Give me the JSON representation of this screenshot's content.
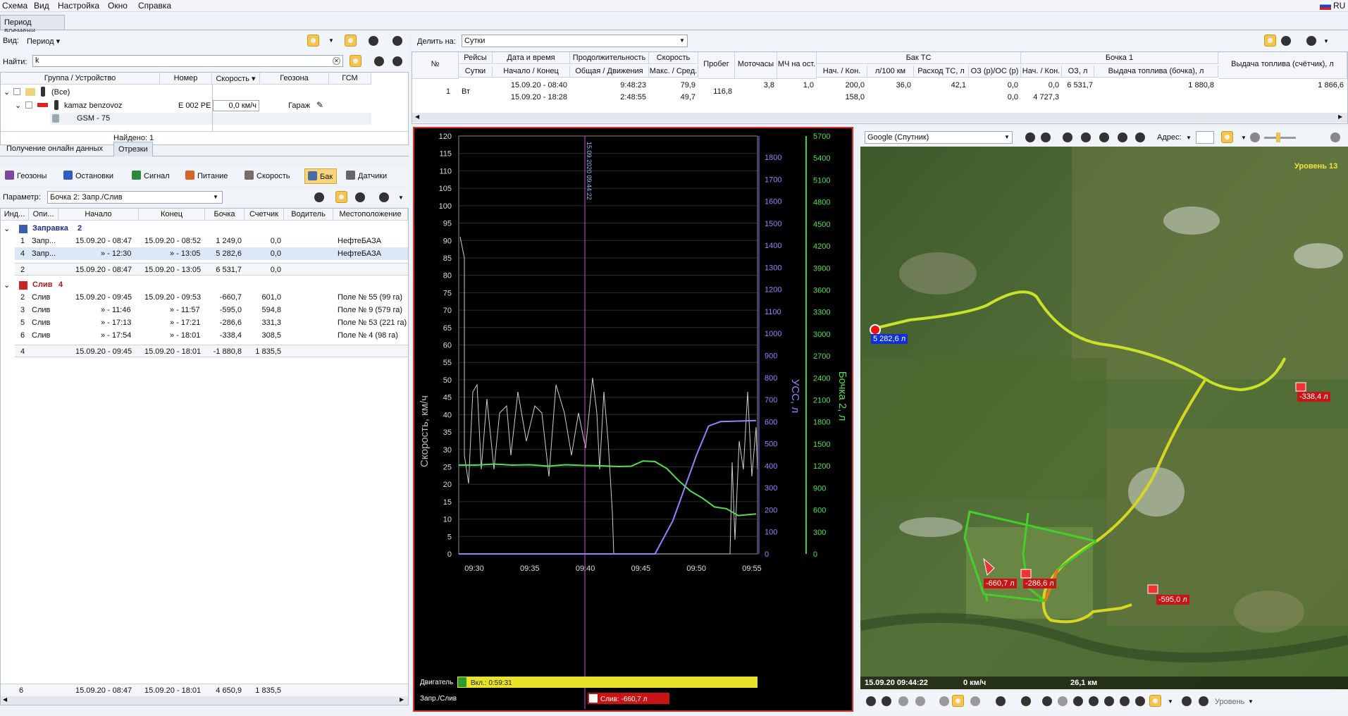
{
  "menu": {
    "items": [
      "Схема",
      "Вид",
      "Настройка",
      "Окно",
      "Справка"
    ],
    "lang": "RU"
  },
  "top_tab": "Период времени",
  "left": {
    "view_label": "Вид:",
    "view_value": "Период ▾",
    "find_label": "Найти:",
    "find_value": "k",
    "columns": [
      "Группа / Устройство",
      "Номер",
      "Скорость ▾",
      "Геозона",
      "ГСМ"
    ],
    "rows": {
      "all": "(Все)",
      "device": "kamaz benzovoz",
      "number": "E 002 PE",
      "speed": "0,0 км/ч",
      "zone": "Гараж",
      "sub": "GSM - 75"
    },
    "found": "Найдено: 1",
    "subtabs": [
      "Получение онлайн данных",
      "Отрезки"
    ],
    "filters": [
      "Геозоны",
      "Остановки",
      "Сигнал",
      "Питание",
      "Скорость",
      "Бак",
      "Датчики"
    ],
    "param_label": "Параметр:",
    "param_value": "Бочка 2: Запр./Слив",
    "seg_columns": [
      "Инд...",
      "Опи...",
      "Начало",
      "Конец",
      "Бочка",
      "Счетчик",
      "Водитель",
      "Местоположение"
    ],
    "group1": {
      "title": "Заправка",
      "count": "2"
    },
    "refuel": [
      {
        "idx": "1",
        "op": "Запр...",
        "start": "15.09.20 - 08:47",
        "end": "15.09.20 - 08:52",
        "tank": "1 249,0",
        "cnt": "0,0",
        "loc": "НефтеБАЗА"
      },
      {
        "idx": "4",
        "op": "Запр...",
        "start": "» - 12:30",
        "end": "» - 13:05",
        "tank": "5 282,6",
        "cnt": "0,0",
        "loc": "НефтеБАЗА"
      }
    ],
    "refuel_sum": {
      "idx": "2",
      "start": "15.09.20 - 08:47",
      "end": "15.09.20 - 13:05",
      "tank": "6 531,7",
      "cnt": "0,0"
    },
    "group2": {
      "title": "Слив",
      "count": "4"
    },
    "drain": [
      {
        "idx": "2",
        "op": "Слив",
        "start": "15.09.20 - 09:45",
        "end": "15.09.20 - 09:53",
        "tank": "-660,7",
        "cnt": "601,0",
        "loc": "Поле № 55 (99 га)"
      },
      {
        "idx": "3",
        "op": "Слив",
        "start": "» - 11:46",
        "end": "» - 11:57",
        "tank": "-595,0",
        "cnt": "594,8",
        "loc": "Поле № 9 (579 га)"
      },
      {
        "idx": "5",
        "op": "Слив",
        "start": "» - 17:13",
        "end": "» - 17:21",
        "tank": "-286,6",
        "cnt": "331,3",
        "loc": "Поле № 53 (221 га)"
      },
      {
        "idx": "6",
        "op": "Слив",
        "start": "» - 17:54",
        "end": "» - 18:01",
        "tank": "-338,4",
        "cnt": "308,5",
        "loc": "Поле № 4 (98 га)"
      }
    ],
    "drain_sum": {
      "idx": "4",
      "start": "15.09.20 - 09:45",
      "end": "15.09.20 - 18:01",
      "tank": "-1 880,8",
      "cnt": "1 835,5"
    },
    "total": {
      "idx": "6",
      "start": "15.09.20 - 08:47",
      "end": "15.09.20 - 18:01",
      "tank": "4 650,9",
      "cnt": "1 835,5"
    }
  },
  "report": {
    "split_label": "Делить на:",
    "split_value": "Сутки",
    "h1": [
      "№",
      "Рейсы",
      "Дата и время",
      "Продолжительность",
      "Скорость",
      "Пробег",
      "Моточасы",
      "МЧ на ост.",
      "Бак ТС",
      "Бочка 1",
      "Выдача топлива (счётчик), л"
    ],
    "h2": [
      "Сутки",
      "Начало / Конец",
      "Общая / Движения",
      "Макс. / Сред.",
      "Нач. / Кон.",
      "л/100 км",
      "Расход ТС, л",
      "ОЗ (р)/ОС (р)",
      "Нач. / Кон.",
      "ОЗ, л",
      "Выдача топлива (бочка), л"
    ],
    "row": {
      "n": "1",
      "day": "Вт",
      "dt1": "15.09.20 - 08:40",
      "dt2": "15.09.20 - 18:28",
      "dur1": "9:48:23",
      "dur2": "2:48:55",
      "sp1": "79,9",
      "sp2": "49,7",
      "mil": "116,8",
      "moto": "3,8",
      "mch": "1,0",
      "tank1": "200,0",
      "tank2": "158,0",
      "l100": "36,0",
      "cons": "42,1",
      "oz1": "0,0",
      "oz2": "0,0",
      "b1a": "0,0",
      "b1b": "4 727,3",
      "oz": "6 531,7",
      "barrel": "1 880,8",
      "counter": "1 866,6"
    }
  },
  "chart_data": {
    "type": "line",
    "x_ticks": [
      "09:30",
      "09:35",
      "09:40",
      "09:45",
      "09:50",
      "09:55"
    ],
    "y_left": {
      "label": "Скорость, км/ч",
      "ticks": [
        "120",
        "115",
        "110",
        "105",
        "100",
        "95",
        "90",
        "85",
        "80",
        "75",
        "70",
        "65",
        "60",
        "55",
        "50",
        "45",
        "40",
        "35",
        "30",
        "25",
        "20",
        "15",
        "10",
        "5",
        "0"
      ]
    },
    "y_mid": {
      "label": "УСС, л",
      "ticks": [
        "1800",
        "1700",
        "1600",
        "1500",
        "1400",
        "1300",
        "1200",
        "1100",
        "1000",
        "900",
        "800",
        "700",
        "600",
        "500",
        "400",
        "300",
        "200",
        "100",
        "0"
      ]
    },
    "y_right": {
      "label": "Бочка 2, л",
      "ticks": [
        "5700",
        "5400",
        "5100",
        "4800",
        "4500",
        "4200",
        "3900",
        "3600",
        "3300",
        "3000",
        "2700",
        "2400",
        "2100",
        "1800",
        "1500",
        "1200",
        "900",
        "600",
        "300",
        "0"
      ]
    },
    "cursor": "15.09.2020 09:44:22",
    "engine_label": "Двигатель",
    "engine_value": "Вкл.: 0:59:31",
    "drain_label": "Запр./Слив",
    "drain_value": "Слив: -660,7 л",
    "series": [
      {
        "name": "Бочка 2",
        "color": "#4fe04f",
        "x": [
          0,
          6,
          12,
          18,
          24,
          30,
          36,
          42,
          48,
          54,
          58,
          62,
          66,
          70,
          74,
          78,
          82,
          86,
          90,
          94,
          100
        ],
        "y": [
          25.5,
          25.5,
          25.8,
          25.5,
          25.6,
          25.2,
          25.6,
          25.4,
          25.3,
          25.1,
          25.2,
          26.7,
          26.5,
          24.5,
          21,
          18,
          16,
          13.5,
          13,
          11,
          11.5
        ]
      },
      {
        "name": "УСС",
        "color": "#8b87ff",
        "x": [
          0,
          50,
          56,
          62,
          66,
          72,
          76,
          80,
          84,
          88,
          100
        ],
        "y": [
          0,
          0,
          0,
          0,
          0,
          150,
          300,
          450,
          580,
          600,
          605
        ]
      }
    ]
  },
  "map": {
    "source": "Google (Спутник)",
    "addr_label": "Адрес:",
    "level": "Уровень 13",
    "markers": [
      "5 282,6 л",
      "-338,4 л",
      "-660,7 л",
      "-286,6 л",
      "-595,0 л"
    ],
    "status": {
      "dt": "15.09.20  09:44:22",
      "speed": "0 км/ч",
      "dist": "26,1 км"
    },
    "zoom_label": "Уровень"
  }
}
